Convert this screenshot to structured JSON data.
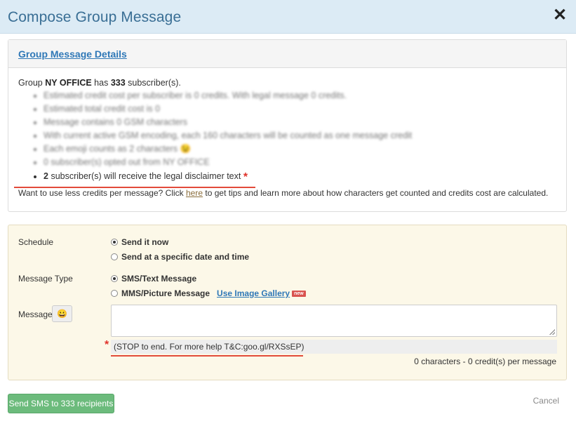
{
  "modal": {
    "title": "Compose Group Message",
    "close_icon": "close-icon"
  },
  "details": {
    "heading": "Group Message Details",
    "group_prefix": "Group",
    "group_name": "NY OFFICE",
    "group_has": "has",
    "subscriber_count": "333",
    "group_suffix": "subscriber(s).",
    "blurred_items": [
      "Estimated credit cost per subscriber is 0 credits. With legal message 0 credits.",
      "Estimated total credit cost is 0",
      "Message contains 0 GSM characters",
      "With current active GSM encoding, each 160 characters will be counted as one message credit",
      "Each emoji counts as 2 characters 😉",
      "0 subscriber(s) opted out from NY OFFICE"
    ],
    "legal_count": "2",
    "legal_text": "subscriber(s) will receive the legal disclaimer text",
    "star": "*",
    "tips_prefix": "Want to use less credits per message? Click",
    "tips_link": "here",
    "tips_suffix": "to get tips and learn more about how characters get counted and credits cost are calculated."
  },
  "form": {
    "schedule_label": "Schedule",
    "schedule_options": [
      "Send it now",
      "Send at a specific date and time"
    ],
    "message_type_label": "Message Type",
    "message_type_options": [
      "SMS/Text Message",
      "MMS/Picture Message"
    ],
    "gallery_link": "Use Image Gallery",
    "new_badge": "new",
    "message_label": "Message",
    "emoji_button": "😀",
    "message_value": "",
    "legal_footer": "(STOP to end. For more help T&C:goo.gl/RXSsEP)",
    "star": "*",
    "char_count": "0 characters - 0 credit(s) per message"
  },
  "footer": {
    "send_button": "Send SMS to 333 recipients",
    "cancel": "Cancel"
  }
}
